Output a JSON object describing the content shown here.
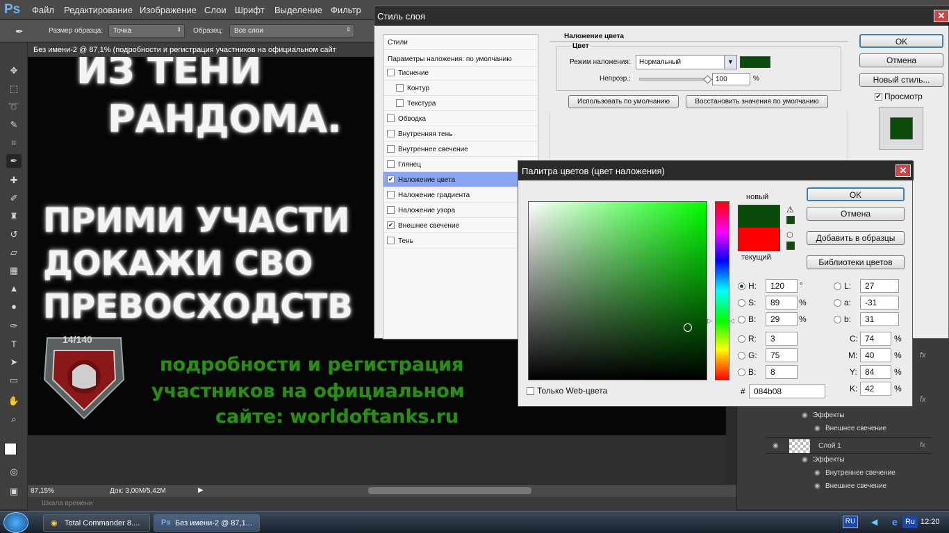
{
  "app": {
    "logo": "Ps"
  },
  "menu": [
    "Файл",
    "Редактирование",
    "Изображение",
    "Слои",
    "Шрифт",
    "Выделение",
    "Фильтр"
  ],
  "options": {
    "sample_size_label": "Размер образца:",
    "sample_size_value": "Точка",
    "sample_label": "Образец:",
    "sample_value": "Все слои"
  },
  "document": {
    "tab_title": "Без имени-2 @ 87,1% (подробности и регистрация участников на официальном сайт",
    "poster_line1": "ИЗ ТЕНИ",
    "poster_line2": "РАНДОМА.",
    "poster_line3": "ПРИМИ  УЧАСТИ",
    "poster_line4": "ДОКАЖИ      СВО",
    "poster_line5": "ПРЕВОСХОДСТВ",
    "badge_text": "14/140",
    "green_line1": "подробности и регистрация",
    "green_line2": "участников на официальном",
    "green_line3": "сайте: worldoftanks.ru"
  },
  "status": {
    "zoom": "87,15%",
    "doc": "Док: 3,00M/5,42M",
    "timeline": "Шкала времени"
  },
  "layer_style": {
    "title": "Стиль слоя",
    "list_header": "Стили",
    "list_default": "Параметры наложения: по умолчанию",
    "items": [
      {
        "label": "Тиснение",
        "checked": ""
      },
      {
        "label": "Контур",
        "checked": ""
      },
      {
        "label": "Текстура",
        "checked": ""
      },
      {
        "label": "Обводка",
        "checked": ""
      },
      {
        "label": "Внутренняя тень",
        "checked": ""
      },
      {
        "label": "Внутреннее свечение",
        "checked": ""
      },
      {
        "label": "Глянец",
        "checked": ""
      },
      {
        "label": "Наложение цвета",
        "checked": "✔"
      },
      {
        "label": "Наложение градиента",
        "checked": ""
      },
      {
        "label": "Наложение узора",
        "checked": ""
      },
      {
        "label": "Внешнее свечение",
        "checked": "✔"
      },
      {
        "label": "Тень",
        "checked": ""
      }
    ],
    "section_title": "Наложение цвета",
    "group_title": "Цвет",
    "blend_mode_label": "Режим наложения:",
    "blend_mode_value": "Нормальный",
    "opacity_label": "Непрозр.:",
    "opacity_value": "100",
    "opacity_unit": "%",
    "use_default": "Использовать по умолчанию",
    "restore_default": "Восстановить значения по умолчанию",
    "ok": "OK",
    "cancel": "Отмена",
    "new_style": "Новый стиль...",
    "preview": "Просмотр",
    "overlay_color": "#0b4b0b"
  },
  "color_picker": {
    "title": "Палитра цветов (цвет наложения)",
    "new_label": "новый",
    "current_label": "текущий",
    "new_color": "#084b08",
    "current_color": "#ff0000",
    "ok": "OK",
    "cancel": "Отмена",
    "add_swatches": "Добавить в образцы",
    "color_libraries": "Библиотеки цветов",
    "web_only": "Только Web-цвета",
    "hex_label": "#",
    "hex": "084b08",
    "H": "120",
    "H_unit": "°",
    "S": "89",
    "S_unit": "%",
    "B": "29",
    "B_unit": "%",
    "R": "3",
    "G": "75",
    "Bl": "8",
    "L": "27",
    "a": "-31",
    "b": "31",
    "C": "74",
    "M": "40",
    "Y": "84",
    "K": "42",
    "pct": "%"
  },
  "layers": {
    "effects1": "Эффекты",
    "outer_glow1": "Внешнее свечение",
    "layer1": "Слой 1",
    "effects2": "Эффекты",
    "inner_glow": "Внутреннее свечение",
    "outer_glow2": "Внешнее свечение",
    "fx": "fx"
  },
  "taskbar": {
    "task1": "Total Commander 8....",
    "task2": "Без имени-2 @ 87,1...",
    "lang": "RU",
    "lang2": "Ru",
    "clock": "12:20"
  }
}
